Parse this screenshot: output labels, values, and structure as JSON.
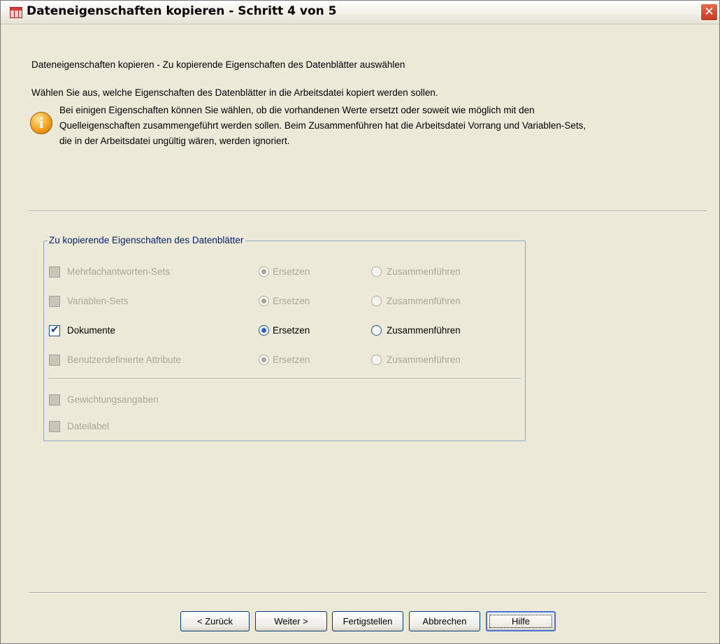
{
  "window": {
    "title": "Dateneigenschaften kopieren - Schritt 4 von 5",
    "close_glyph": "✕"
  },
  "intro": {
    "heading": "Dateneigenschaften kopieren - Zu kopierende Eigenschaften des Datenblätter auswählen",
    "subheading": "Wählen Sie aus, welche Eigenschaften des Datenblätter in die Arbeitsdatei kopiert werden sollen.",
    "info_lines": [
      "Bei einigen Eigenschaften können Sie wählen, ob die vorhandenen Werte ersetzt oder soweit wie möglich mit den",
      "Quelleigenschaften zusammengeführt werden sollen. Beim Zusammenführen hat die Arbeitsdatei Vorrang und Variablen-Sets,",
      "die in der Arbeitsdatei ungültig wären, werden ignoriert."
    ]
  },
  "group": {
    "title": "Zu kopierende Eigenschaften des Datenblätter",
    "rows": [
      {
        "label": "Mehrfachantworten-Sets",
        "checked": false,
        "enabled": false,
        "replace": "Ersetzen",
        "merge": "Zusammenführen",
        "selected": "replace"
      },
      {
        "label": "Variablen-Sets",
        "checked": false,
        "enabled": false,
        "replace": "Ersetzen",
        "merge": "Zusammenführen",
        "selected": "replace"
      },
      {
        "label": "Dokumente",
        "checked": true,
        "enabled": true,
        "replace": "Ersetzen",
        "merge": "Zusammenführen",
        "selected": "replace"
      },
      {
        "label": "Benutzerdefinierte Attribute",
        "checked": false,
        "enabled": false,
        "replace": "Ersetzen",
        "merge": "Zusammenführen",
        "selected": "replace"
      }
    ],
    "extra_options": [
      {
        "label": "Gewichtungsangaben",
        "checked": false,
        "enabled": false
      },
      {
        "label": "Dateilabel",
        "checked": false,
        "enabled": false
      }
    ]
  },
  "buttons": {
    "back": "< Zurück",
    "next": "Weiter >",
    "finish": "Fertigstellen",
    "cancel": "Abbrechen",
    "help": "Hilfe"
  },
  "colors": {
    "accent": "#2a63c8",
    "window_bg": "#ece9d8",
    "group_title": "#0a246a",
    "disabled_text": "#aca899"
  },
  "icons": {
    "app": "table-grid-icon",
    "info": "info-icon",
    "close": "close-icon",
    "check": "checkmark-icon"
  }
}
